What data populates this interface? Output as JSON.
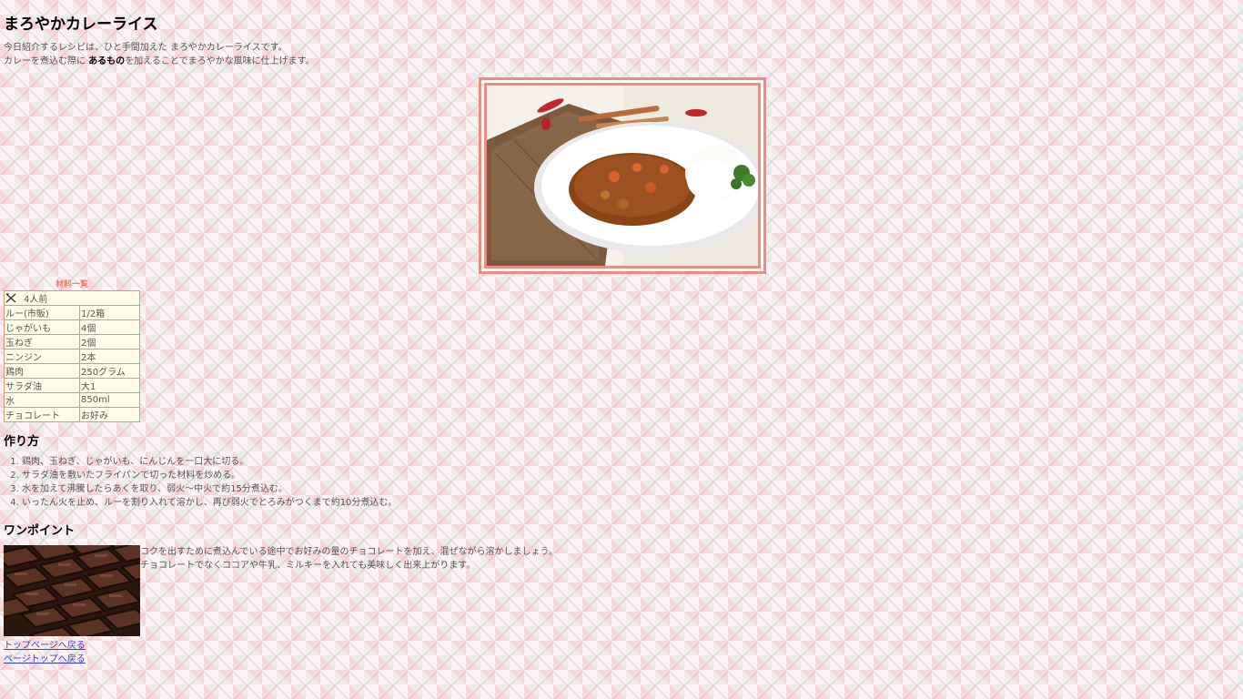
{
  "title": "まろやかカレーライス",
  "intro": {
    "line1": "今日紹介するレシピは、ひと手間加えた まろやかカレーライスです。",
    "line2_pre": "カレーを煮込む際に ",
    "line2_bold": "あるもの",
    "line2_post": "を加えることでまろやかな風味に仕上げます。"
  },
  "ingredients": {
    "caption": "材料一覧",
    "servings": "4人前",
    "rows": [
      {
        "name": "ルー(市販)",
        "amount": "1/2箱"
      },
      {
        "name": "じゃがいも",
        "amount": "4個"
      },
      {
        "name": "玉ねぎ",
        "amount": "2個"
      },
      {
        "name": "ニンジン",
        "amount": "2本"
      },
      {
        "name": "鶏肉",
        "amount": "250グラム"
      },
      {
        "name": "サラダ油",
        "amount": "大1"
      },
      {
        "name": "水",
        "amount": "850ml"
      },
      {
        "name": "チョコレート",
        "amount": "お好み"
      }
    ]
  },
  "method": {
    "heading": "作り方",
    "steps": [
      "鶏肉、玉ねぎ、じゃがいも、にんじんを一口大に切る。",
      "サラダ油を敷いたフライパンで切った材料を炒める。",
      "水を加えて沸騰したらあくを取り、弱火～中火で約15分煮込む。",
      "いったん火を止め、ルーを割り入れて溶かし、再び弱火でとろみがつくまで約10分煮込む。"
    ]
  },
  "point": {
    "heading": "ワンポイント",
    "line1": "コクを出すために煮込んでいる途中でお好みの量のチョコレートを加え、混ぜながら溶かしましょう。",
    "line2": "チョコレートでなくココアや牛乳、ミルキーを入れても美味しく出来上がります。"
  },
  "links": {
    "top_page": "トップページへ戻る",
    "page_top": "ページトップへ戻る"
  },
  "icons": {
    "servings": "cutlery-icon"
  },
  "colors": {
    "accent": "#ef8c7d",
    "table_bg": "#fffde8",
    "link": "#3b3bd6"
  }
}
